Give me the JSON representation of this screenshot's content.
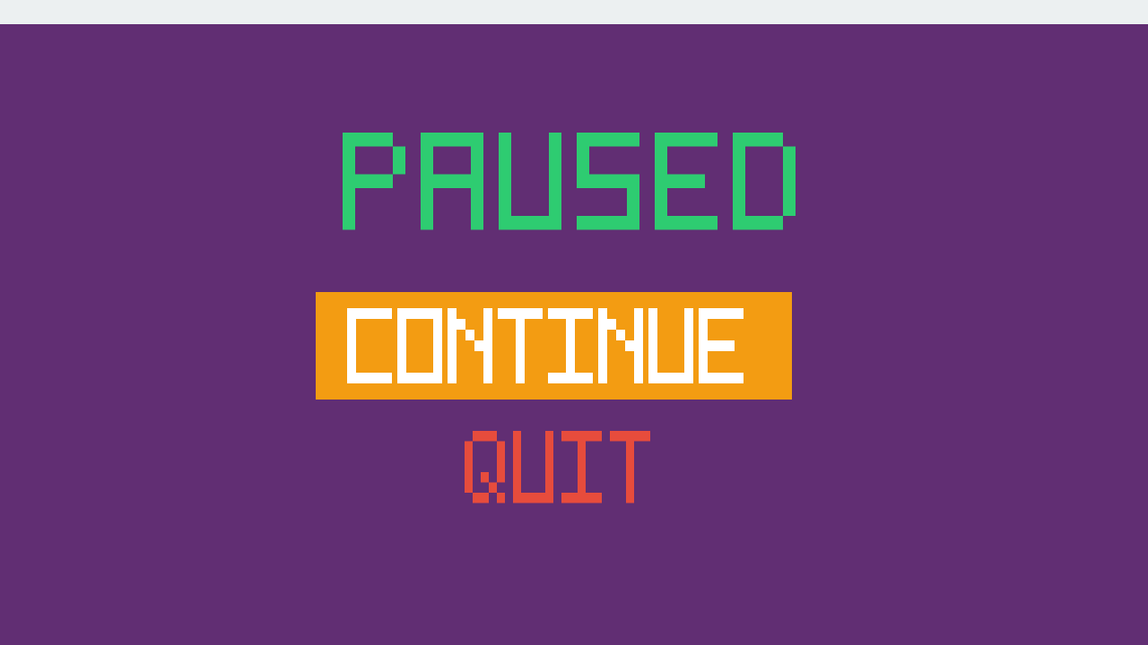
{
  "menu": {
    "title": "PAUSED",
    "continue_label": "CONTINUE",
    "quit_label": "QUIT"
  },
  "colors": {
    "background": "#612e73",
    "title": "#2ecc71",
    "continue_bg": "#f39c12",
    "continue_text": "#ffffff",
    "quit_text": "#e74c3c"
  }
}
